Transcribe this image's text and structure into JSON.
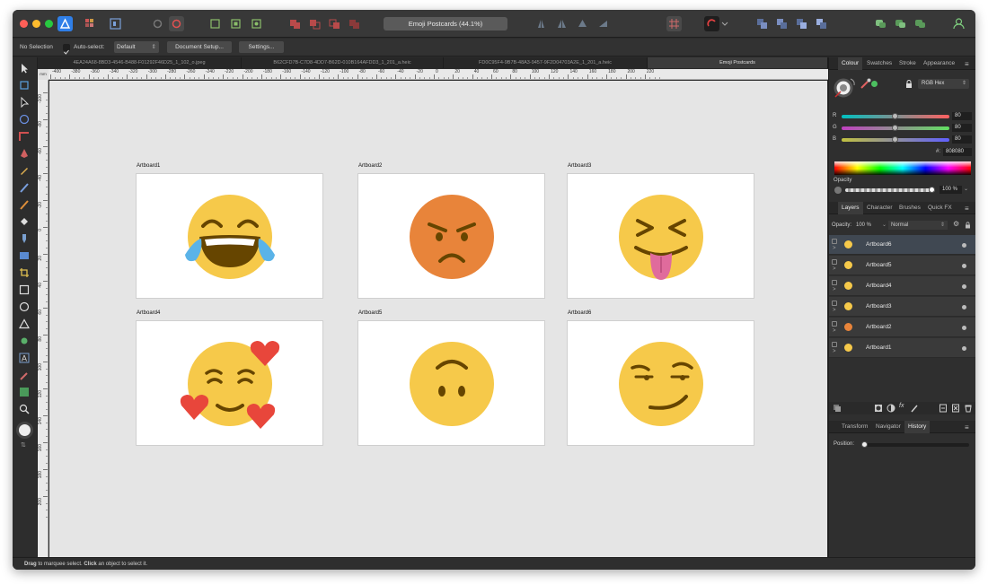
{
  "app": {
    "document_title": "Emoji Postcards (44.1%)"
  },
  "context_toolbar": {
    "selection_status": "No Selection",
    "auto_select_label": "Auto-select:",
    "auto_select_value": "Default",
    "document_setup_label": "Document Setup...",
    "settings_label": "Settings..."
  },
  "doc_tabs": [
    {
      "label": "4EA24A68-8BD3-4546-B488-F01292F46D25_1_102_o.jpeg"
    },
    {
      "label": "B62CFD7B-C7D8-4DD7-B62D-010B164AFDD3_1_201_a.heic"
    },
    {
      "label": "FD0C95F4-9B7B-48A3-9457-9F2D04703A2E_1_201_a.heic"
    },
    {
      "label": "Emoji Postcards"
    }
  ],
  "ruler": {
    "unit": "mm",
    "h_ticks": [
      "-400",
      "-380",
      "-360",
      "-340",
      "-320",
      "-300",
      "-280",
      "-260",
      "-240",
      "-220",
      "-200",
      "-180",
      "-160",
      "-140",
      "-120",
      "-100",
      "-80",
      "-60",
      "-40",
      "-20",
      "0",
      "20",
      "40",
      "60",
      "80",
      "100",
      "120",
      "140",
      "160",
      "180",
      "200",
      "220"
    ],
    "v_ticks": [
      "-100",
      "-80",
      "-60",
      "-40",
      "-20",
      "0",
      "20",
      "40",
      "60",
      "80",
      "100",
      "120",
      "140",
      "160",
      "180",
      "200"
    ]
  },
  "artboards": [
    {
      "label": "Artboard1",
      "emoji": "tears-of-joy"
    },
    {
      "label": "Artboard2",
      "emoji": "angry"
    },
    {
      "label": "Artboard3",
      "emoji": "tongue-squint"
    },
    {
      "label": "Artboard4",
      "emoji": "smiling-hearts"
    },
    {
      "label": "Artboard5",
      "emoji": "upside-down"
    },
    {
      "label": "Artboard6",
      "emoji": "smirk"
    }
  ],
  "colour_panel": {
    "tabs": [
      "Colour",
      "Swatches",
      "Stroke",
      "Appearance"
    ],
    "mode": "RGB Hex",
    "r_label": "R",
    "r_value": "80",
    "g_label": "G",
    "g_value": "80",
    "b_label": "B",
    "b_value": "80",
    "hex_label": "#:",
    "hex_value": "808080",
    "opacity_label": "Opacity",
    "opacity_value": "100 %"
  },
  "layers_panel": {
    "tabs": [
      "Layers",
      "Character",
      "Brushes",
      "Quick FX"
    ],
    "opacity_label": "Opacity:",
    "opacity_value": "100 %",
    "blend_mode": "Normal",
    "layers": [
      {
        "name": "Artboard6",
        "color": "#f6c94a",
        "selected": true
      },
      {
        "name": "Artboard5",
        "color": "#f6c94a",
        "selected": false
      },
      {
        "name": "Artboard4",
        "color": "#f6c94a",
        "selected": false
      },
      {
        "name": "Artboard3",
        "color": "#f6c94a",
        "selected": false
      },
      {
        "name": "Artboard2",
        "color": "#e8843a",
        "selected": false
      },
      {
        "name": "Artboard1",
        "color": "#f6c94a",
        "selected": false
      }
    ]
  },
  "history_panel": {
    "tabs": [
      "Transform",
      "Navigator",
      "History"
    ],
    "position_label": "Position:"
  },
  "status_bar": {
    "drag_word": "Drag",
    "drag_text": " to marquee select. ",
    "click_word": "Click",
    "click_text": " an object to select it."
  },
  "colors": {
    "emoji_yellow": "#f6c94a",
    "emoji_orange": "#e8843a",
    "heart_red": "#e8463b",
    "tear_blue": "#5ab3e8",
    "tongue_pink": "#e06b9c",
    "feature_brown": "#664500"
  }
}
